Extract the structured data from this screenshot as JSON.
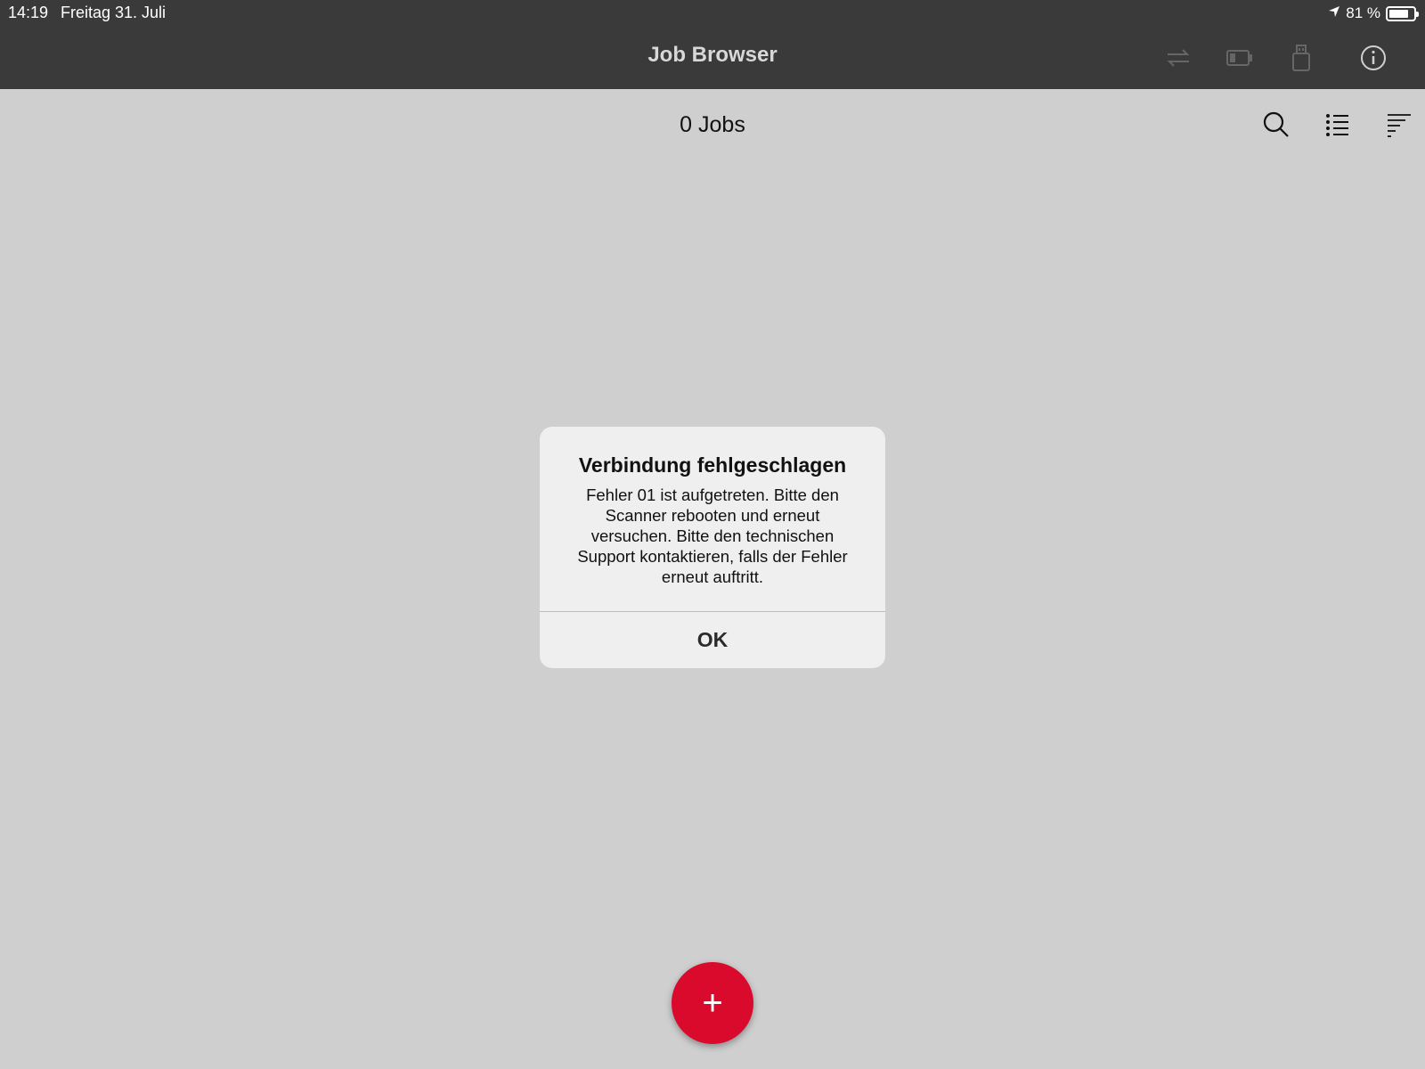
{
  "status_bar": {
    "time": "14:19",
    "date": "Freitag 31. Juli",
    "battery_text": "81 %",
    "battery_level": 0.81,
    "location_icon": "location-arrow-icon"
  },
  "nav": {
    "title": "Job Browser",
    "icons": [
      "sync-icon",
      "battery-icon",
      "usb-drive-icon",
      "info-icon"
    ]
  },
  "toolbar": {
    "jobs_count": "0 Jobs",
    "icons": [
      "search-icon",
      "list-icon",
      "sort-icon"
    ]
  },
  "dialog": {
    "title": "Verbindung fehlgeschlagen",
    "message": "Fehler 01 ist aufgetreten. Bitte den Scanner rebooten und erneut versuchen. Bitte den technischen Support kontaktieren, falls der Fehler erneut auftritt.",
    "ok_label": "OK"
  },
  "fab": {
    "label": "+"
  },
  "colors": {
    "background": "#cfcfcf",
    "topbar": "#3a3a3a",
    "accent": "#d90a2c",
    "dialog": "#efefef"
  }
}
